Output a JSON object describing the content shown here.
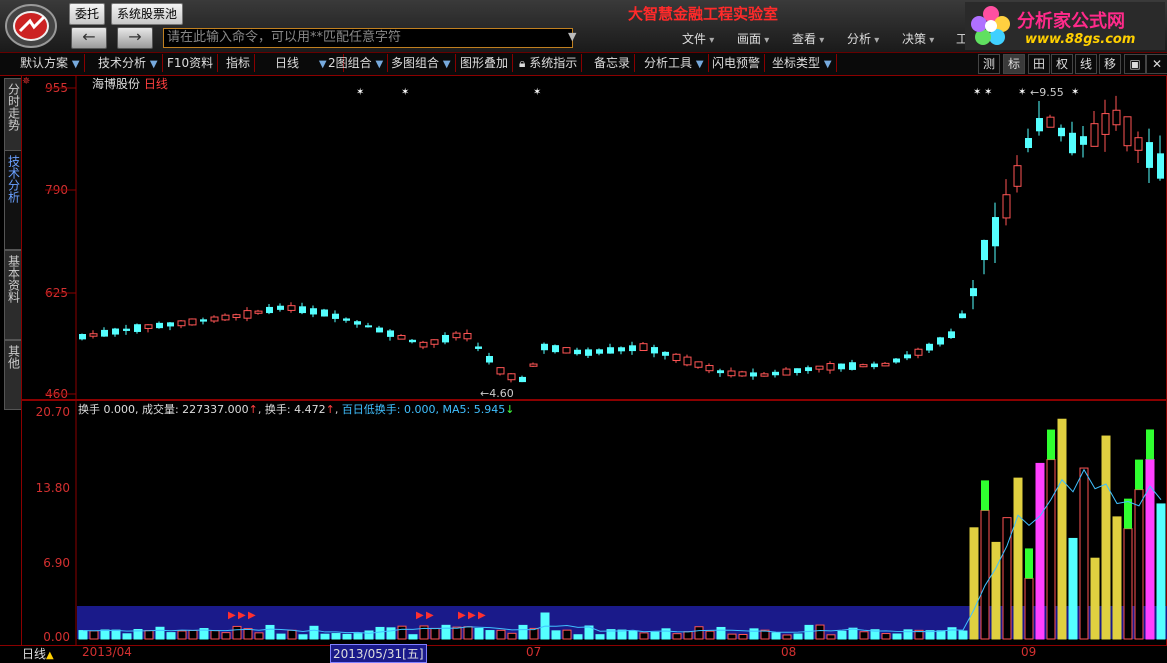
{
  "topbar": {
    "order_button": "委托",
    "stock_pool_button": "系统股票池",
    "command_placeholder": "请在此输入命令，可以用**匹配任意字符",
    "title": "大智慧金融工程实验室",
    "menus": [
      "文件",
      "画面",
      "查看",
      "分析",
      "决策",
      "工"
    ],
    "brand": "分析家公式网",
    "brand_url": "www.88gs.com"
  },
  "toolbar": {
    "items": [
      "默认方案",
      "技术分析",
      "F10资料",
      "指标",
      "日线",
      "2图组合",
      "多图组合",
      "图形叠加",
      "系统指示",
      "备忘录",
      "分析工具",
      "闪电预警",
      "坐标类型"
    ],
    "right_items": [
      "测",
      "标",
      "田",
      "权",
      "线",
      "移"
    ]
  },
  "side_tabs": [
    {
      "label": "分时走势"
    },
    {
      "label": "技术分析"
    },
    {
      "label": "基本资料"
    },
    {
      "label": "其他"
    }
  ],
  "price_chart": {
    "stock_name": "海博股份",
    "period": "日线",
    "y_labels": [
      "955",
      "790",
      "625",
      "460"
    ],
    "max_label": "9.55",
    "min_label": "4.60"
  },
  "volume_chart": {
    "legend": {
      "huanshou": "换手 0.000,",
      "chengjiaoliang": "成交量: 227337.000",
      "huanshou2": "换手: 4.472",
      "bairi": "百日低换手: 0.000,",
      "ma5": "MA5: 5.945"
    },
    "y_labels": [
      "20.70",
      "13.80",
      "6.90",
      "0.00"
    ]
  },
  "bottombar": {
    "period_label": "日线",
    "dates": [
      "2013/04",
      "2013/05/31[五]",
      "07",
      "08",
      "09"
    ]
  },
  "colors": {
    "up": "#ff5555",
    "down": "#55ffff",
    "axis": "#8b0000",
    "accent_yellow": "#e0d040",
    "accent_green": "#30ff30",
    "accent_magenta": "#ff40ff",
    "band_blue": "#1a1a8a"
  },
  "chart_data": {
    "type": "candlestick",
    "series": [
      {
        "name": "price",
        "y_range": [
          460,
          955
        ]
      },
      {
        "name": "turnover",
        "y_range": [
          0,
          20.7
        ]
      }
    ]
  }
}
